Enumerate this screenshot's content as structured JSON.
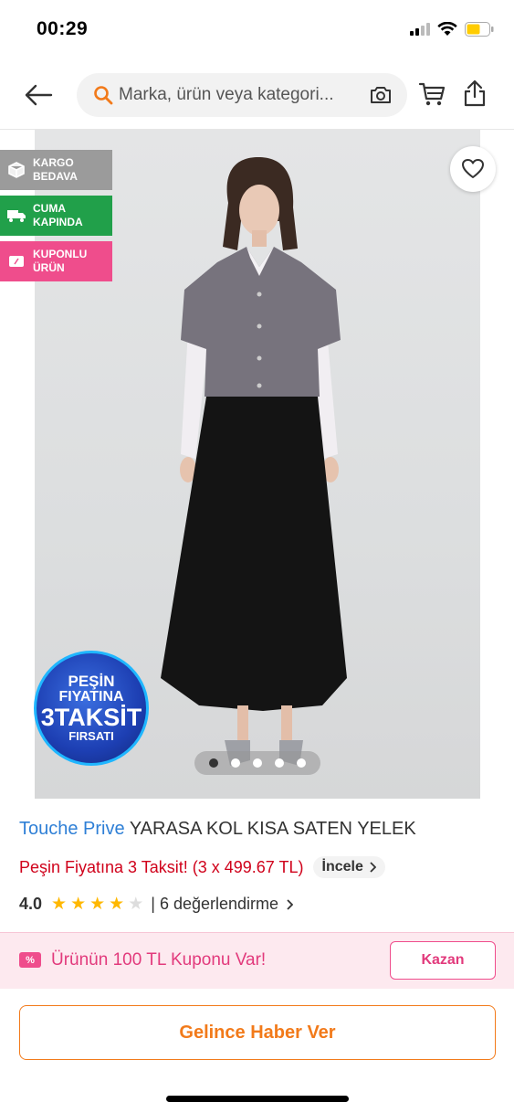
{
  "status_bar": {
    "time": "00:29"
  },
  "header": {
    "search_placeholder": "Marka, ürün veya kategori..."
  },
  "badges": [
    {
      "line1": "KARGO",
      "line2": "BEDAVA",
      "color": "#9b9b9b"
    },
    {
      "line1": "CUMA",
      "line2": "KAPINDA",
      "color": "#21a04a"
    },
    {
      "line1": "KUPONLU",
      "line2": "ÜRÜN",
      "color": "#ef4d8c"
    }
  ],
  "promo_seal": {
    "line1": "PEŞİN",
    "line2": "FIYATINA",
    "line3": "3TAKSİT",
    "line4": "FIRSATI"
  },
  "gallery": {
    "image_count": 5,
    "active_index": 0
  },
  "product": {
    "brand": "Touche Prive",
    "name": "YARASA KOL KISA SATEN YELEK",
    "installment_text": "Peşin Fiyatına 3 Taksit! (3 x 499.67 TL)",
    "incele_label": "İncele",
    "rating": "4.0",
    "rating_value": 4,
    "review_text": "| 6 değerlendirme"
  },
  "coupon": {
    "text": "Ürünün 100 TL Kuponu Var!",
    "button": "Kazan"
  },
  "notify_button": "Gelince Haber Ver",
  "colors": {
    "brand": "#2e7fd6",
    "accent": "#f27a1a",
    "coupon": "#ef4d8c",
    "promo_red": "#d0021b"
  }
}
